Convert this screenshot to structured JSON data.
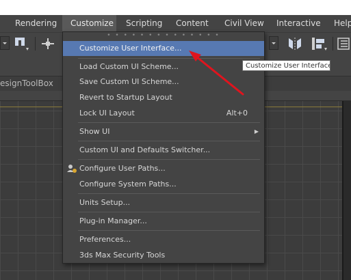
{
  "menubar": {
    "items": [
      {
        "label": "Rendering"
      },
      {
        "label": "Customize"
      },
      {
        "label": "Scripting"
      },
      {
        "label": "Content"
      },
      {
        "label": "Civil View"
      },
      {
        "label": "Interactive"
      },
      {
        "label": "Help"
      }
    ]
  },
  "toolbox": {
    "label": "esignToolBox"
  },
  "dropdown": {
    "items": [
      {
        "label": "Customize User Interface...",
        "highlighted": true
      },
      {
        "label": "Load Custom UI Scheme..."
      },
      {
        "label": "Save Custom UI Scheme..."
      },
      {
        "label": "Revert to Startup Layout"
      },
      {
        "label": "Lock UI Layout",
        "shortcut": "Alt+0"
      },
      {
        "label": "Show UI",
        "submenu": true
      },
      {
        "label": "Custom UI and Defaults Switcher..."
      },
      {
        "label": "Configure User Paths...",
        "icon": "user-paths-icon"
      },
      {
        "label": "Configure System Paths..."
      },
      {
        "label": "Units Setup..."
      },
      {
        "label": "Plug-in Manager..."
      },
      {
        "label": "Preferences..."
      },
      {
        "label": "3ds Max Security Tools"
      }
    ]
  },
  "tooltip": {
    "text": "Customize User Interface"
  },
  "colors": {
    "menubar": "#444444",
    "highlight": "#5779b2",
    "annotation_arrow": "#e0141e",
    "viewport": "#3c3c3c"
  }
}
